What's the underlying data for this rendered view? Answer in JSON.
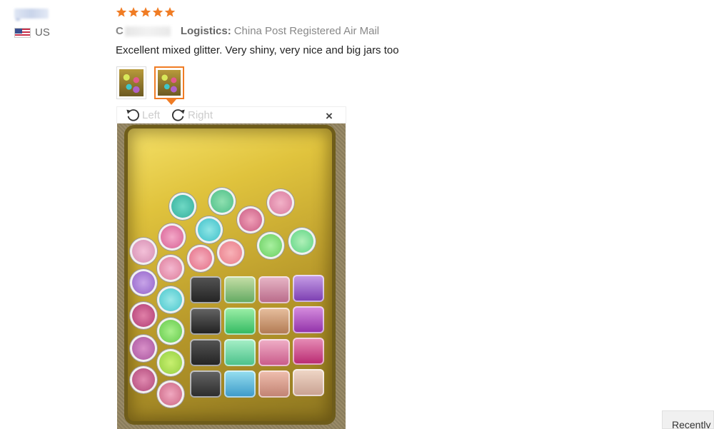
{
  "reviewer": {
    "country_code": "US",
    "flag_icon": "us-flag-icon"
  },
  "rating": {
    "stars": 5,
    "max": 5,
    "color": "#f07c24"
  },
  "meta": {
    "color_label": "C",
    "logistics_label": "Logistics:",
    "logistics_value": "China Post Registered Air Mail"
  },
  "review": {
    "text": "Excellent mixed glitter. Very shiny, very nice and big jars too"
  },
  "viewer": {
    "rotate_left_label": "Left",
    "rotate_right_label": "Right",
    "close_label": "×",
    "selected_thumb": 2,
    "thumb_count": 2
  },
  "footer": {
    "recent_tab_label": "Recently"
  },
  "colors": {
    "accent": "#f07c24",
    "text": "#222222",
    "muted": "#999999"
  }
}
